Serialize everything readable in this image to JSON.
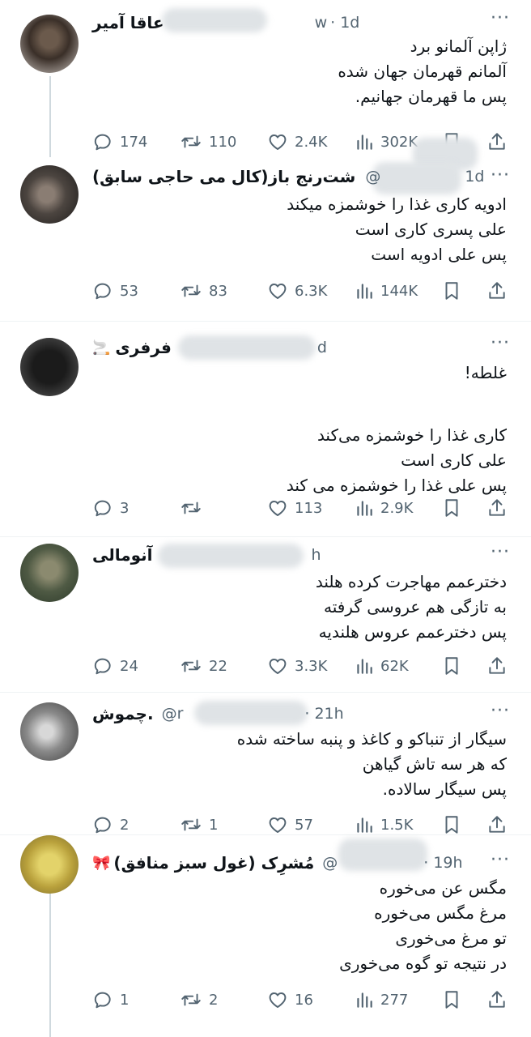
{
  "tweets": [
    {
      "name": "عاقا آمیر",
      "handle_tail": "w",
      "time": "· 1d",
      "more": "···",
      "body": [
        "ژاپن آلمانو برد",
        "آلمانم قهرمان جهان شده",
        "پس ما قهرمان جهانیم."
      ],
      "stats": {
        "replies": "174",
        "reposts": "110",
        "likes": "2.4K",
        "views": "302K"
      }
    },
    {
      "name": "شت‌رنج باز(کال می حاجی سابق)",
      "handle_tail": "@",
      "time": "1d",
      "more": "···",
      "body": [
        "ادویه کاری غذا را خوشمزه میکند",
        "علی پسری کاری است",
        "پس علی ادویه است"
      ],
      "stats": {
        "replies": "53",
        "reposts": "83",
        "likes": "6.3K",
        "views": "144K"
      }
    },
    {
      "name": "فرفری",
      "emoji": "🚬",
      "time": "d",
      "more": "···",
      "body": [
        "غلطه!",
        "",
        "کاری غذا را خوشمزه می‌کند",
        "علی کاری است",
        "پس علی غذا را خوشمزه می کند"
      ],
      "stats": {
        "replies": "3",
        "reposts": "",
        "likes": "113",
        "views": "2.9K"
      }
    },
    {
      "name": "آنومالی",
      "time": "h",
      "more": "···",
      "body": [
        "دخترعمم مهاجرت کرده هلند",
        "به تازگی هم عروسی گرفته",
        "پس دخترعمم عروس هلندیه"
      ],
      "stats": {
        "replies": "24",
        "reposts": "22",
        "likes": "3.3K",
        "views": "62K"
      }
    },
    {
      "name": "چموش.",
      "handle_tail": "@r",
      "time": "· 21h",
      "more": "···",
      "body": [
        "سیگار از تنباکو و کاغذ و پنبه ساخته شده",
        "که هر سه تاش گیاهن",
        "پس سیگار سالاده."
      ],
      "stats": {
        "replies": "2",
        "reposts": "1",
        "likes": "57",
        "views": "1.5K"
      }
    },
    {
      "name": "مُشرِک (غول سبز منافق)",
      "emoji": "🎀",
      "handle_tail": "@",
      "time": "· 19h",
      "more": "···",
      "body": [
        "مگس عن می‌خوره",
        "مرغ مگس می‌خوره",
        "تو مرغ می‌خوری",
        "در نتیجه تو گوه می‌خوری"
      ],
      "stats": {
        "replies": "1",
        "reposts": "2",
        "likes": "16",
        "views": "277"
      }
    }
  ],
  "colors": {
    "text": "#0f1419",
    "secondary": "#536471",
    "thread": "#cfd9de",
    "divider": "#eff3f4"
  },
  "icons": [
    "reply-icon",
    "repost-icon",
    "like-icon",
    "views-icon",
    "bookmark-icon",
    "share-icon"
  ]
}
